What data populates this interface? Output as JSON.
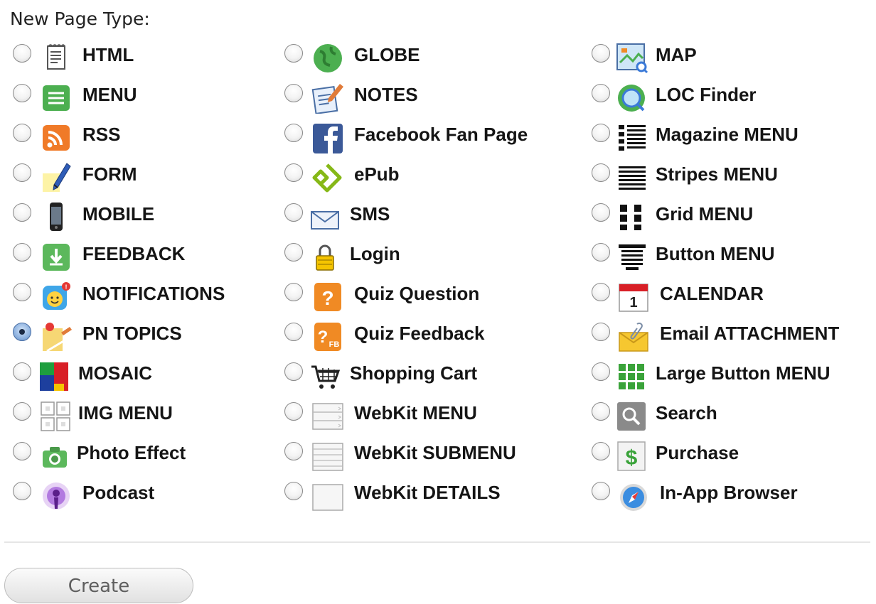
{
  "form": {
    "heading": "New Page Type:",
    "create_label": "Create"
  },
  "columns": [
    [
      {
        "label": "HTML",
        "icon": "html-document-icon",
        "checked": false
      },
      {
        "label": "MENU",
        "icon": "menu-icon",
        "checked": false
      },
      {
        "label": "RSS",
        "icon": "rss-icon",
        "checked": false
      },
      {
        "label": "FORM",
        "icon": "form-pencil-icon",
        "checked": false
      },
      {
        "label": "MOBILE",
        "icon": "mobile-phone-icon",
        "checked": false
      },
      {
        "label": "FEEDBACK",
        "icon": "feedback-download-icon",
        "checked": false
      },
      {
        "label": "NOTIFICATIONS",
        "icon": "notifications-icon",
        "checked": false
      },
      {
        "label": "PN TOPICS",
        "icon": "pn-topics-icon",
        "checked": true
      },
      {
        "label": "MOSAIC",
        "icon": "mosaic-icon",
        "checked": false
      },
      {
        "label": "IMG MENU",
        "icon": "img-menu-icon",
        "checked": false
      },
      {
        "label": "Photo Effect",
        "icon": "camera-icon",
        "checked": false
      },
      {
        "label": "Podcast",
        "icon": "podcast-icon",
        "checked": false
      }
    ],
    [
      {
        "label": "GLOBE",
        "icon": "globe-icon",
        "checked": false
      },
      {
        "label": "NOTES",
        "icon": "notes-icon",
        "checked": false
      },
      {
        "label": "Facebook Fan Page",
        "icon": "facebook-icon",
        "checked": false
      },
      {
        "label": "ePub",
        "icon": "epub-icon",
        "checked": false
      },
      {
        "label": "SMS",
        "icon": "envelope-icon",
        "checked": false
      },
      {
        "label": "Login",
        "icon": "lock-icon",
        "checked": false
      },
      {
        "label": "Quiz Question",
        "icon": "quiz-question-icon",
        "checked": false
      },
      {
        "label": "Quiz Feedback",
        "icon": "quiz-feedback-icon",
        "checked": false
      },
      {
        "label": "Shopping Cart",
        "icon": "shopping-cart-icon",
        "checked": false
      },
      {
        "label": "WebKit MENU",
        "icon": "webkit-menu-icon",
        "checked": false
      },
      {
        "label": "WebKit SUBMENU",
        "icon": "webkit-submenu-icon",
        "checked": false
      },
      {
        "label": "WebKit DETAILS",
        "icon": "webkit-details-icon",
        "checked": false
      }
    ],
    [
      {
        "label": "MAP",
        "icon": "map-icon",
        "checked": false
      },
      {
        "label": "LOC Finder",
        "icon": "loc-finder-icon",
        "checked": false
      },
      {
        "label": "Magazine MENU",
        "icon": "magazine-menu-icon",
        "checked": false
      },
      {
        "label": "Stripes MENU",
        "icon": "stripes-menu-icon",
        "checked": false
      },
      {
        "label": "Grid MENU",
        "icon": "grid-menu-icon",
        "checked": false
      },
      {
        "label": "Button MENU",
        "icon": "button-menu-icon",
        "checked": false
      },
      {
        "label": "CALENDAR",
        "icon": "calendar-icon",
        "checked": false
      },
      {
        "label": "Email ATTACHMENT",
        "icon": "email-attachment-icon",
        "checked": false
      },
      {
        "label": "Large Button MENU",
        "icon": "large-button-menu-icon",
        "checked": false
      },
      {
        "label": "Search",
        "icon": "search-icon",
        "checked": false
      },
      {
        "label": "Purchase",
        "icon": "purchase-icon",
        "checked": false
      },
      {
        "label": "In-App Browser",
        "icon": "compass-browser-icon",
        "checked": false
      }
    ]
  ],
  "icon_colors": {
    "menu": "#4caf50",
    "rss": "#f07a28",
    "feedback": "#5cb85c",
    "facebook": "#3b5998",
    "epub": "#86b817",
    "quiz": "#f08a24",
    "selected_radio": "#5a83bd"
  }
}
